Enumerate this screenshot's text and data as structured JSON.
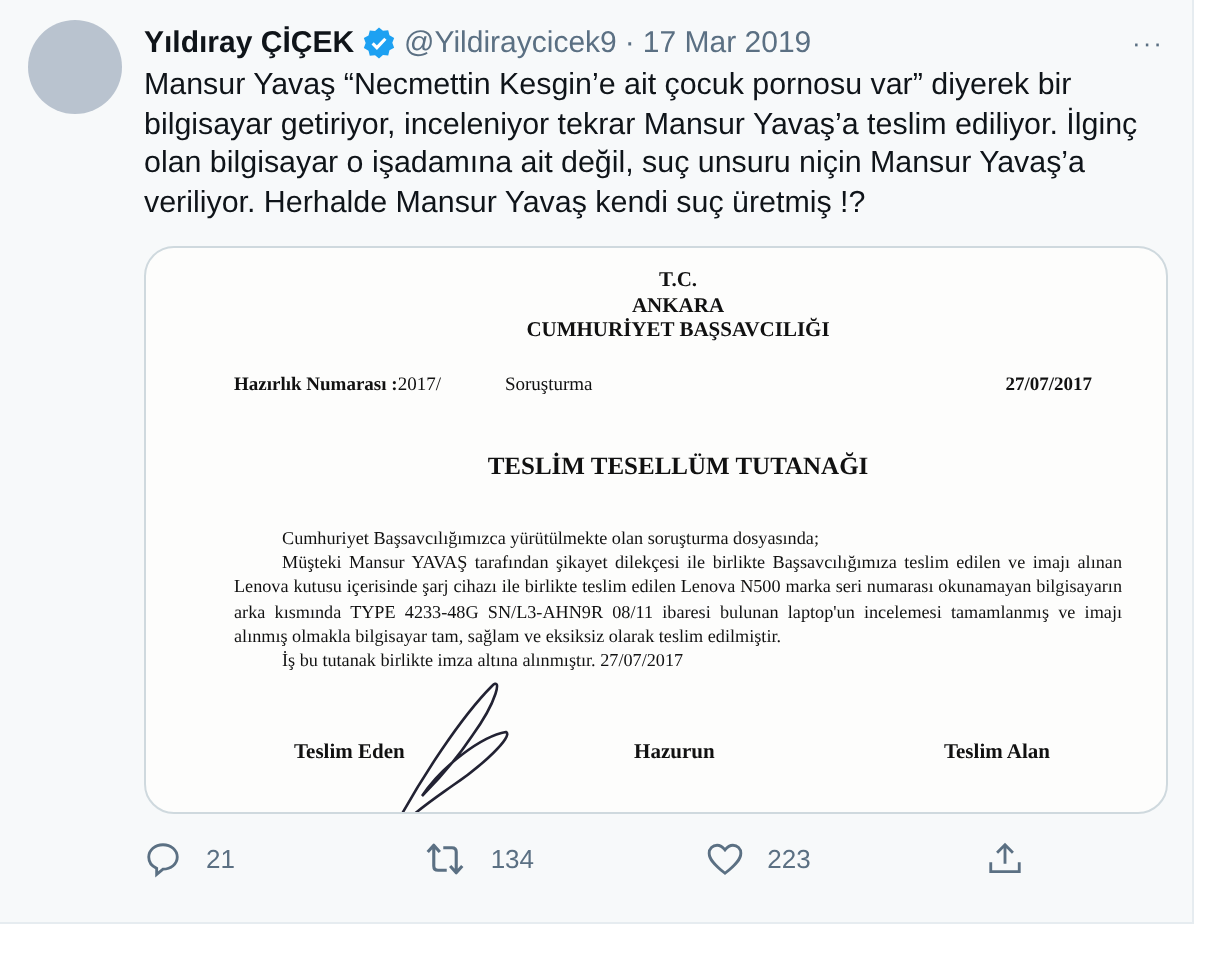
{
  "tweet": {
    "author": "Yıldıray ÇİÇEK",
    "verified": true,
    "handle": "@Yildiraycicek9",
    "separator": "·",
    "date": "17 Mar 2019",
    "more": "···",
    "text": "Mansur Yavaş “Necmettin Kesgin’e ait çocuk pornosu var” diyerek bir bilgisayar getiriyor, inceleniyor tekrar Mansur Yavaş’a teslim ediliyor. İlginç olan bilgisayar o işadamına ait değil, suç unsuru niçin Mansur Yavaş’a veriliyor. Herhalde Mansur Yavaş kendi suç üretmiş !?"
  },
  "document": {
    "header": [
      "T.C.",
      "ANKARA",
      "CUMHURİYET BAŞSAVCILIĞI"
    ],
    "reference": {
      "label": "Hazırlık Numarası :",
      "number": "2017/",
      "type": "Soruşturma",
      "date": "27/07/2017"
    },
    "title": "TESLİM TESELLÜM TUTANAĞI",
    "paragraphs": [
      "Cumhuriyet Başsavcılığımızca yürütülmekte olan soruşturma dosyasında;",
      "Müşteki Mansur YAVAŞ tarafından şikayet dilekçesi ile birlikte Başsavcılığımıza teslim edilen ve imajı alınan Lenova kutusu içerisinde şarj cihazı ile birlikte teslim edilen Lenova N500 marka seri numarası okunamayan bilgisayarın arka kısmında TYPE 4233-48G SN/L3-AHN9R 08/11 ibaresi bulunan laptop'un incelemesi tamamlanmış ve imajı alınmış olmakla bilgisayar tam, sağlam ve eksiksiz olarak teslim edilmiştir.",
      "İş bu tutanak birlikte imza altına alınmıştır. 27/07/2017"
    ],
    "signatures": [
      "Teslim Eden",
      "Hazurun",
      "Teslim Alan"
    ]
  },
  "actions": [
    {
      "kind": "reply",
      "count": "21"
    },
    {
      "kind": "retweet",
      "count": "134"
    },
    {
      "kind": "like",
      "count": "223"
    },
    {
      "kind": "share"
    }
  ]
}
